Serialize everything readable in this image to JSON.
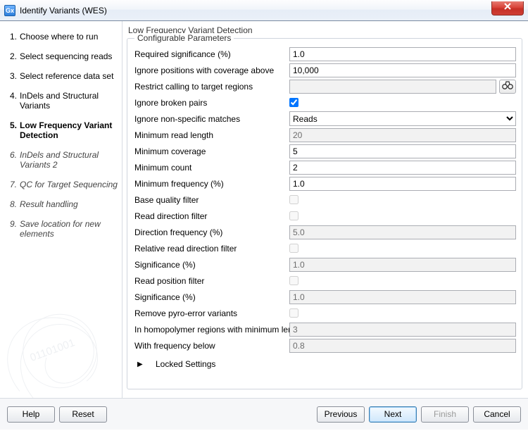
{
  "window": {
    "app_icon_text": "Gx",
    "title": "Identify Variants (WES)"
  },
  "sidebar": {
    "items": [
      {
        "label": "Choose where to run",
        "state": "past"
      },
      {
        "label": "Select sequencing reads",
        "state": "past"
      },
      {
        "label": "Select reference data set",
        "state": "past"
      },
      {
        "label": "InDels and Structural Variants",
        "state": "past"
      },
      {
        "label": "Low Frequency Variant Detection",
        "state": "current"
      },
      {
        "label": "InDels and Structural Variants 2",
        "state": "future"
      },
      {
        "label": "QC for Target Sequencing",
        "state": "future"
      },
      {
        "label": "Result handling",
        "state": "future"
      },
      {
        "label": "Save location for new elements",
        "state": "future"
      }
    ]
  },
  "main": {
    "section_title": "Low Frequency Variant Detection",
    "group_title": "Configurable Parameters",
    "locked_settings_label": "Locked Settings",
    "fields": {
      "required_significance": {
        "label": "Required significance (%)",
        "value": "1.0",
        "enabled": true,
        "type": "text"
      },
      "ignore_cov_above": {
        "label": "Ignore positions with coverage above",
        "value": "10,000",
        "enabled": true,
        "type": "text"
      },
      "restrict_regions": {
        "label": "Restrict calling to target regions",
        "value": "",
        "enabled": true,
        "type": "target"
      },
      "ignore_broken_pairs": {
        "label": "Ignore broken pairs",
        "checked": true,
        "enabled": true,
        "type": "check"
      },
      "ignore_non_specific": {
        "label": "Ignore non-specific matches",
        "value": "Reads",
        "enabled": true,
        "type": "select"
      },
      "min_read_len": {
        "label": "Minimum read length",
        "value": "20",
        "enabled": false,
        "type": "text"
      },
      "min_coverage": {
        "label": "Minimum coverage",
        "value": "5",
        "enabled": true,
        "type": "text"
      },
      "min_count": {
        "label": "Minimum count",
        "value": "2",
        "enabled": true,
        "type": "text"
      },
      "min_freq": {
        "label": "Minimum frequency (%)",
        "value": "1.0",
        "enabled": true,
        "type": "text"
      },
      "base_quality_filter": {
        "label": "Base quality filter",
        "checked": false,
        "enabled": false,
        "type": "check"
      },
      "read_dir_filter": {
        "label": "Read direction filter",
        "checked": false,
        "enabled": false,
        "type": "check"
      },
      "direction_freq": {
        "label": "Direction frequency (%)",
        "value": "5.0",
        "enabled": false,
        "type": "text"
      },
      "rel_read_dir_filter": {
        "label": "Relative read direction filter",
        "checked": false,
        "enabled": false,
        "type": "check"
      },
      "significance1": {
        "label": "Significance (%)",
        "value": "1.0",
        "enabled": false,
        "type": "text"
      },
      "read_pos_filter": {
        "label": "Read position filter",
        "checked": false,
        "enabled": false,
        "type": "check"
      },
      "significance2": {
        "label": "Significance (%)",
        "value": "1.0",
        "enabled": false,
        "type": "text"
      },
      "remove_pyro": {
        "label": "Remove pyro-error variants",
        "checked": false,
        "enabled": false,
        "type": "check"
      },
      "homopolymer_len": {
        "label": "In homopolymer regions with minimum length",
        "value": "3",
        "enabled": false,
        "type": "text"
      },
      "with_freq_below": {
        "label": "With frequency below",
        "value": "0.8",
        "enabled": false,
        "type": "text"
      }
    }
  },
  "footer": {
    "help": "Help",
    "reset": "Reset",
    "previous": "Previous",
    "next": "Next",
    "finish": "Finish",
    "cancel": "Cancel"
  }
}
